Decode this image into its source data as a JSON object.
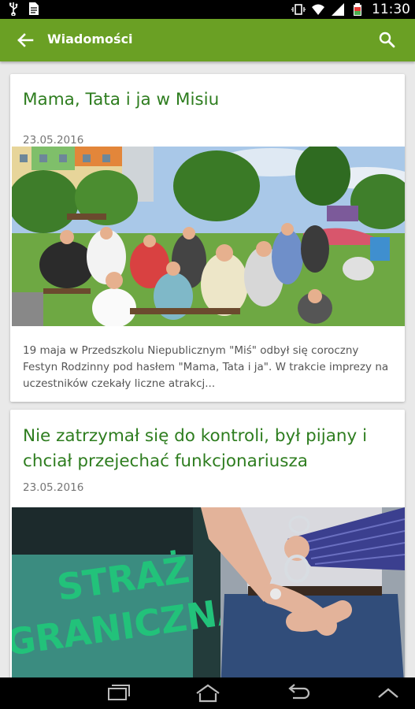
{
  "status_bar": {
    "time": "11:30",
    "icons": [
      "usb-icon",
      "document-icon",
      "vibrate-icon",
      "wifi-icon",
      "signal-icon",
      "battery-icon"
    ]
  },
  "app_bar": {
    "title": "Wiadomości",
    "back_icon": "arrow-back-icon",
    "search_icon": "search-icon",
    "color": "#6aa024"
  },
  "articles": [
    {
      "title": "Mama, Tata i ja w Misiu",
      "date": "23.05.2016",
      "excerpt": "19 maja w Przedszkolu Niepublicznym \"Miś\" odbył się coroczny Festyn Rodzinny pod hasłem \"Mama, Tata i ja\". W trakcie imprezy na uczestników czekały liczne atrakcj..."
    },
    {
      "title": "Nie zatrzymał się do kontroli, był pijany i chciał przejechać funkcjonariusza",
      "date": "23.05.2016",
      "image_text_line1": "STRAŻ",
      "image_text_line2": "GRANICZNA"
    }
  ],
  "nav_bar": {
    "icons": [
      "recent-apps-icon",
      "home-icon",
      "back-icon",
      "up-icon"
    ]
  },
  "colors": {
    "title_green": "#2e7d1f",
    "background": "#e9e9e9"
  }
}
